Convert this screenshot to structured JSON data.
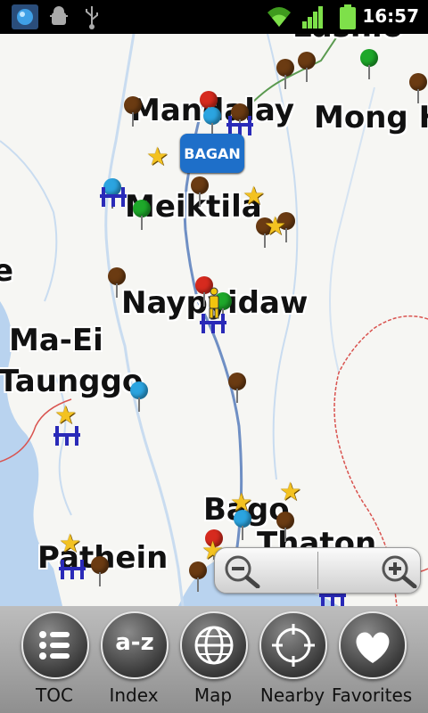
{
  "status_bar": {
    "time": "16:57",
    "icons": [
      "app-globe-icon",
      "android-debug-icon",
      "usb-icon",
      "wifi-icon",
      "signal-icon",
      "battery-icon"
    ]
  },
  "map": {
    "places": {
      "lashio": "Lashio",
      "mandalay": "Mandalay",
      "mong": "Mong H",
      "meiktila": "Meiktila",
      "naypyidaw": "Naypyidaw",
      "ma_ei": "Ma-Ei",
      "taunggo": "Taunggo",
      "bago": "Bago",
      "thaton": "Thaton",
      "pathein": "Pathein",
      "edge_e": "e"
    },
    "callout": "BAGAN",
    "colors": {
      "water": "#b9d3ef",
      "road": "#6f8fc4",
      "border": "#d9534f",
      "callout": "#1e6fc9"
    }
  },
  "zoom": {
    "out": "zoom-out-icon",
    "in": "zoom-in-icon"
  },
  "toolbar": {
    "toc": "TOC",
    "index": "Index",
    "index_icon_text": "a-z",
    "map": "Map",
    "nearby": "Nearby",
    "favorites": "Favorites"
  }
}
